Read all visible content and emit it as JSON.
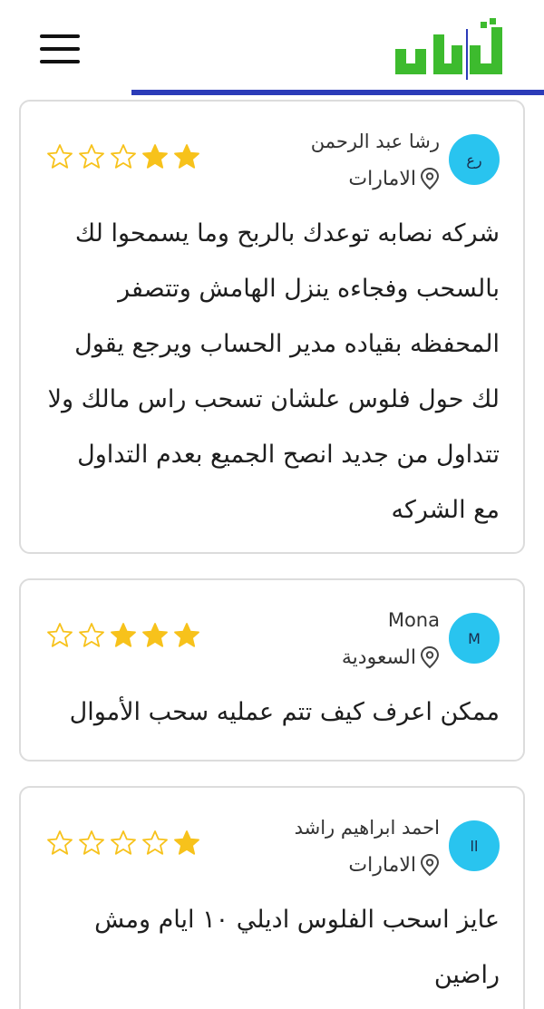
{
  "header": {
    "logo_text": "تداول",
    "menu_icon": "hamburger-menu-icon",
    "accent_color": "#2b3bb8",
    "logo_color": "#3dbb2e"
  },
  "reviews": [
    {
      "initials": "رع",
      "name": "رشا عبد الرحمن",
      "location": "الامارات",
      "rating": 2,
      "text": "شركه نصابه توعدك بالربح وما يسمحوا لك بالسحب وفجاءه ينزل الهامش وتتصفر المحفظه بقياده مدير الحساب ويرجع يقول لك حول فلوس علشان تسحب راس مالك ولا تتداول من جديد انصح الجميع بعدم التداول مع الشركه"
    },
    {
      "initials": "M",
      "name": "Mona",
      "location": "السعودية",
      "rating": 3,
      "text": "ممكن اعرف كيف تتم عمليه سحب الأموال"
    },
    {
      "initials": "اا",
      "name": "احمد ابراهيم راشد",
      "location": "الامارات",
      "rating": 1,
      "text": "عايز اسحب الفلوس اديلي ١٠ ايام ومش راضين"
    }
  ],
  "colors": {
    "avatar": "#29c4ef",
    "star_filled": "#f7c21b",
    "star_empty_stroke": "#f7c21b"
  }
}
